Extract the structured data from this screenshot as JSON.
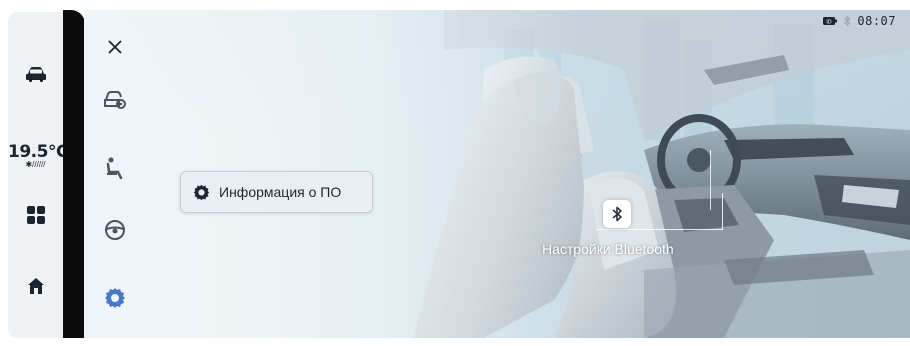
{
  "status_bar": {
    "time": "08:07",
    "battery_icon": "battery-icon",
    "bluetooth_icon": "bluetooth-status-icon"
  },
  "dock": {
    "temperature": "19.5°C",
    "fan_indicator": "✱//////",
    "items": [
      {
        "name": "car-icon"
      },
      {
        "name": "apps-grid-icon"
      },
      {
        "name": "home-icon"
      }
    ]
  },
  "menu": {
    "close_icon": "close-icon",
    "items": [
      {
        "name": "car-settings-icon"
      },
      {
        "name": "seat-icon"
      },
      {
        "name": "steering-wheel-icon"
      },
      {
        "name": "gear-icon",
        "active": true
      }
    ]
  },
  "popover": {
    "label": "Информация о ПО",
    "icon": "gear-icon"
  },
  "hotspot": {
    "label": "Настройки Bluetooth",
    "icon": "bluetooth-icon"
  },
  "colors": {
    "accent": "#4a78c8",
    "dark": "#0b0b0b"
  }
}
